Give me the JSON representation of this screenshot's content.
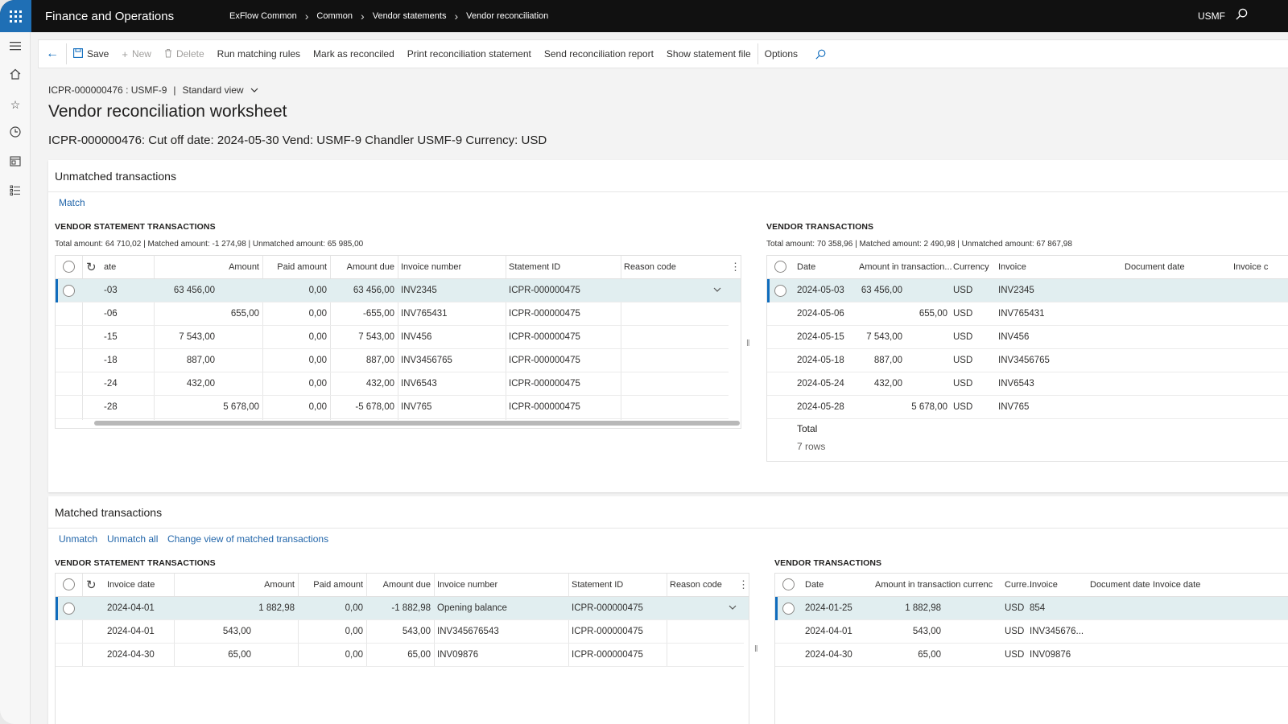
{
  "app": {
    "name": "Finance and Operations",
    "company": "USMF"
  },
  "breadcrumbs": [
    "ExFlow Common",
    "Common",
    "Vendor statements",
    "Vendor reconciliation"
  ],
  "actions": {
    "save": "Save",
    "new": "New",
    "delete": "Delete",
    "run_matching_rules": "Run matching rules",
    "mark_as_reconciled": "Mark as reconciled",
    "print_statement": "Print reconciliation statement",
    "send_report": "Send reconciliation report",
    "show_file": "Show statement file",
    "options": "Options"
  },
  "record": {
    "id": "ICPR-000000476 : USMF-9",
    "separator": "|",
    "view": "Standard view"
  },
  "page_title": "Vendor reconciliation worksheet",
  "subheading": "ICPR-000000476: Cut off date: 2024-05-30 Vend: USMF-9 Chandler USMF-9 Currency: USD",
  "unmatched": {
    "title": "Unmatched transactions",
    "match_label": "Match",
    "statement": {
      "label": "VENDOR STATEMENT TRANSACTIONS",
      "summary": "Total amount: 64 710,02 | Matched amount: -1 274,98 | Unmatched amount: 65 985,00",
      "columns": [
        "ate",
        "Amount",
        "Paid amount",
        "Amount due",
        "Invoice number",
        "Statement ID",
        "Reason code"
      ],
      "rows": [
        [
          "-03",
          "63 456,00",
          "0,00",
          "63 456,00",
          "INV2345",
          "ICPR-000000475",
          ""
        ],
        [
          "-06",
          "655,00",
          "0,00",
          "-655,00",
          "INV765431",
          "ICPR-000000475",
          ""
        ],
        [
          "-15",
          "7 543,00",
          "0,00",
          "7 543,00",
          "INV456",
          "ICPR-000000475",
          ""
        ],
        [
          "-18",
          "887,00",
          "0,00",
          "887,00",
          "INV3456765",
          "ICPR-000000475",
          ""
        ],
        [
          "-24",
          "432,00",
          "0,00",
          "432,00",
          "INV6543",
          "ICPR-000000475",
          ""
        ],
        [
          "-28",
          "5 678,00",
          "0,00",
          "-5 678,00",
          "INV765",
          "ICPR-000000475",
          ""
        ]
      ]
    },
    "vendor": {
      "label": "VENDOR TRANSACTIONS",
      "summary": "Total amount: 70 358,96 | Matched amount: 2 490,98 | Unmatched amount: 67 867,98",
      "columns": [
        "Date",
        "Amount in transaction...",
        "Currency",
        "Invoice",
        "Document date",
        "Invoice c"
      ],
      "rows": [
        [
          "2024-05-03",
          "63 456,00",
          "USD",
          "INV2345",
          "",
          ""
        ],
        [
          "2024-05-06",
          "655,00",
          "USD",
          "INV765431",
          "",
          ""
        ],
        [
          "2024-05-15",
          "7 543,00",
          "USD",
          "INV456",
          "",
          ""
        ],
        [
          "2024-05-18",
          "887,00",
          "USD",
          "INV3456765",
          "",
          ""
        ],
        [
          "2024-05-24",
          "432,00",
          "USD",
          "INV6543",
          "",
          ""
        ],
        [
          "2024-05-28",
          "5 678,00",
          "USD",
          "INV765",
          "",
          ""
        ]
      ],
      "total_label": "Total",
      "rows_label": "7 rows"
    }
  },
  "matched": {
    "title": "Matched transactions",
    "unmatch_label": "Unmatch",
    "unmatch_all_label": "Unmatch all",
    "change_view_label": "Change view of matched transactions",
    "statement": {
      "label": "VENDOR STATEMENT TRANSACTIONS",
      "columns": [
        "Invoice date",
        "Amount",
        "Paid amount",
        "Amount due",
        "Invoice number",
        "Statement ID",
        "Reason code"
      ],
      "rows": [
        [
          "2024-04-01",
          "1 882,98",
          "0,00",
          "-1 882,98",
          "Opening balance",
          "ICPR-000000475",
          ""
        ],
        [
          "2024-04-01",
          "543,00",
          "0,00",
          "543,00",
          "INV345676543",
          "ICPR-000000475",
          ""
        ],
        [
          "2024-04-30",
          "65,00",
          "0,00",
          "65,00",
          "INV09876",
          "ICPR-000000475",
          ""
        ]
      ]
    },
    "vendor": {
      "label": "VENDOR TRANSACTIONS",
      "columns": [
        "Date",
        "Amount in transaction currency",
        "Curre...",
        "Invoice",
        "Document date",
        "Invoice date"
      ],
      "rows": [
        [
          "2024-01-25",
          "1 882,98",
          "USD",
          "854",
          "",
          ""
        ],
        [
          "2024-04-01",
          "543,00",
          "USD",
          "INV345676...",
          "",
          ""
        ],
        [
          "2024-04-30",
          "65,00",
          "USD",
          "INV09876",
          "",
          ""
        ]
      ]
    }
  },
  "icons": {
    "waffle": "waffle-icon",
    "search": "search-icon",
    "hamburger": "hamburger-icon",
    "home": "home-icon",
    "favorites": "star-icon",
    "recent": "clock-icon",
    "workspaces": "workspace-icon",
    "modules": "list-icon",
    "back": "back-arrow-icon",
    "save": "save-icon",
    "new": "plus-icon",
    "delete": "trash-icon",
    "refresh": "refresh-icon"
  },
  "colors": {
    "accent": "#0f6cbd",
    "topbar": "#111111",
    "selected_row": "#e1eef0"
  }
}
